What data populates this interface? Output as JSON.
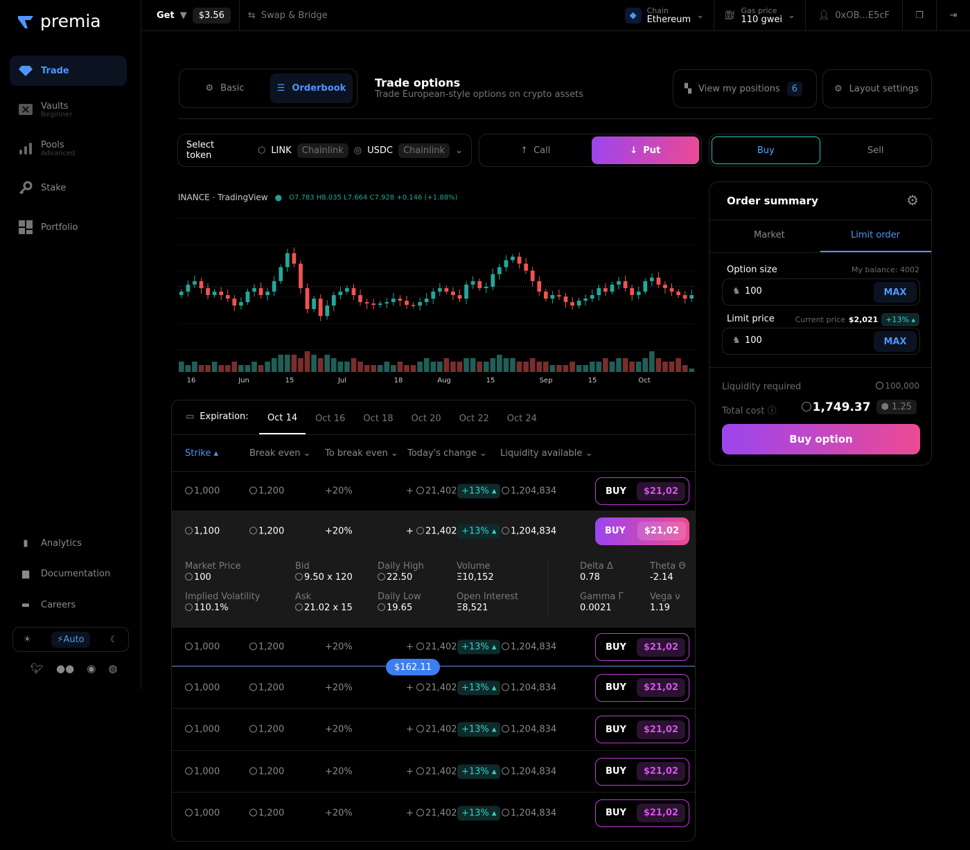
{
  "brand": {
    "name": "premia",
    "accent": "#4f94ff"
  },
  "sidebar": {
    "items": [
      {
        "label": "Trade",
        "icon": "diamond-icon"
      },
      {
        "label": "Vaults",
        "sub": "Beginner",
        "icon": "vault-icon"
      },
      {
        "label": "Pools",
        "sub": "Advanced",
        "icon": "bars-icon"
      },
      {
        "label": "Stake",
        "icon": "key-icon"
      },
      {
        "label": "Portfolio",
        "icon": "grid-icon"
      }
    ],
    "bottom": [
      {
        "label": "Analytics"
      },
      {
        "label": "Documentation"
      },
      {
        "label": "Careers"
      }
    ],
    "theme": {
      "auto": "Auto"
    }
  },
  "topbar": {
    "get": "Get",
    "price": "$3.56",
    "swap": "Swap & Bridge",
    "chain_label": "Chain",
    "chain": "Ethereum",
    "gas_label": "Gas price",
    "gas": "110 gwei",
    "wallet": "0xOB...E5cF"
  },
  "header": {
    "basic": "Basic",
    "orderbook": "Orderbook",
    "title": "Trade options",
    "subtitle": "Trade European-style options on crypto assets",
    "positions": "View my positions",
    "positions_count": "6",
    "layout": "Layout settings"
  },
  "controls": {
    "select_token": "Select token",
    "token1": "LINK",
    "token1_src": "Chainlink",
    "token2": "USDC",
    "token2_src": "Chainlink",
    "call": "Call",
    "put": "Put",
    "buy": "Buy",
    "sell": "Sell"
  },
  "chart_header": {
    "source": "INANCE · TradingView",
    "o": "O7.783",
    "h": "H8.035",
    "l": "L7.664",
    "c": "C7.928",
    "chg": "+0.146 (+1.88%)"
  },
  "chart_data": {
    "type": "candlestick",
    "title": "INANCE · TradingView",
    "x_ticks": [
      "16",
      "Jun",
      "15",
      "Jul",
      "18",
      "Aug",
      "15",
      "Sep",
      "15",
      "Oct"
    ],
    "ylim": [
      6.4,
      8.6
    ],
    "closes": [
      7.55,
      7.65,
      7.7,
      7.6,
      7.5,
      7.55,
      7.5,
      7.45,
      7.35,
      7.4,
      7.55,
      7.6,
      7.5,
      7.55,
      7.7,
      7.9,
      8.1,
      7.95,
      7.6,
      7.3,
      7.45,
      7.2,
      7.35,
      7.5,
      7.55,
      7.6,
      7.5,
      7.4,
      7.38,
      7.36,
      7.38,
      7.4,
      7.45,
      7.42,
      7.36,
      7.35,
      7.4,
      7.45,
      7.55,
      7.6,
      7.55,
      7.5,
      7.45,
      7.65,
      7.7,
      7.6,
      7.62,
      7.8,
      7.9,
      8.0,
      8.05,
      7.95,
      7.85,
      7.7,
      7.55,
      7.45,
      7.5,
      7.48,
      7.4,
      7.35,
      7.42,
      7.45,
      7.5,
      7.6,
      7.55,
      7.65,
      7.7,
      7.6,
      7.5,
      7.55,
      7.7,
      7.75,
      7.65,
      7.6,
      7.55,
      7.5,
      7.45,
      7.5
    ],
    "volumes": [
      3,
      2,
      3,
      2,
      2,
      3,
      2,
      2,
      3,
      2,
      2,
      3,
      2,
      3,
      4,
      5,
      5,
      5,
      4,
      6,
      5,
      4,
      5,
      4,
      3,
      3,
      4,
      3,
      2,
      2,
      2,
      3,
      2,
      3,
      2,
      2,
      3,
      4,
      3,
      3,
      4,
      3,
      3,
      4,
      4,
      3,
      3,
      4,
      5,
      4,
      4,
      3,
      3,
      4,
      3,
      3,
      2,
      2,
      2,
      3,
      2,
      2,
      3,
      3,
      4,
      3,
      4,
      4,
      3,
      3,
      4,
      6,
      4,
      3,
      3,
      4,
      2,
      1
    ]
  },
  "expiration": {
    "label": "Expiration:",
    "tabs": [
      "Oct 14",
      "Oct 16",
      "Oct 18",
      "Oct 20",
      "Oct 22",
      "Oct 24"
    ]
  },
  "table": {
    "headers": [
      "Strike",
      "Break even",
      "To break even",
      "Today's change",
      "Liquidity available"
    ],
    "rows": [
      {
        "strike": "1,000",
        "be": "1,200",
        "tbe": "+20%",
        "chg": "21,402",
        "badge": "+13%",
        "liq": "1,204,834",
        "buy": "BUY",
        "price": "$21,02"
      },
      {
        "strike": "1,100",
        "be": "1,200",
        "tbe": "+20%",
        "chg": "21,402",
        "badge": "+13%",
        "liq": "1,204,834",
        "buy": "BUY",
        "price": "$21,02"
      },
      {
        "strike": "1,000",
        "be": "1,200",
        "tbe": "+20%",
        "chg": "21,402",
        "badge": "+13%",
        "liq": "1,204,834",
        "buy": "BUY",
        "price": "$21,02"
      },
      {
        "strike": "1,000",
        "be": "1,200",
        "tbe": "+20%",
        "chg": "21,402",
        "badge": "+13%",
        "liq": "1,204,834",
        "buy": "BUY",
        "price": "$21,02"
      },
      {
        "strike": "1,000",
        "be": "1,200",
        "tbe": "+20%",
        "chg": "21,402",
        "badge": "+13%",
        "liq": "1,204,834",
        "buy": "BUY",
        "price": "$21,02"
      },
      {
        "strike": "1,000",
        "be": "1,200",
        "tbe": "+20%",
        "chg": "21,402",
        "badge": "+13%",
        "liq": "1,204,834",
        "buy": "BUY",
        "price": "$21,02"
      },
      {
        "strike": "1,000",
        "be": "1,200",
        "tbe": "+20%",
        "chg": "21,402",
        "badge": "+13%",
        "liq": "1,204,834",
        "buy": "BUY",
        "price": "$21,02"
      }
    ],
    "details": [
      {
        "l": "Market Price",
        "v": "100"
      },
      {
        "l": "Bid",
        "v": "9.50 x 120"
      },
      {
        "l": "Daily High",
        "v": "22.50"
      },
      {
        "l": "Volume",
        "v": "Ξ10,152"
      },
      {
        "l": "Delta Δ",
        "v": "0.78"
      },
      {
        "l": "Theta Θ",
        "v": "-2.14"
      },
      {
        "l": "Implied Volatility",
        "v": "110.1%"
      },
      {
        "l": "Ask",
        "v": "21.02 x 15"
      },
      {
        "l": "Daily Low",
        "v": "19.65"
      },
      {
        "l": "Open Interest",
        "v": "Ξ8,521"
      },
      {
        "l": "Gamma Γ",
        "v": "0.0021"
      },
      {
        "l": "Vega ν",
        "v": "1.19"
      }
    ],
    "spot_marker": "$162.11"
  },
  "order": {
    "title": "Order summary",
    "tab_market": "Market",
    "tab_limit": "Limit order",
    "size_label": "Option size",
    "balance": "My balance: 4002",
    "size": "100",
    "max": "MAX",
    "limit_label": "Limit price",
    "current_label": "Current price",
    "current": "$2,021",
    "current_badge": "+13%",
    "limit": "100",
    "liq_label": "Liquidity required",
    "liq": "100,000",
    "cost_label": "Total cost",
    "cost": "1,749.37",
    "cost_alt": "1.25",
    "cta": "Buy option"
  }
}
